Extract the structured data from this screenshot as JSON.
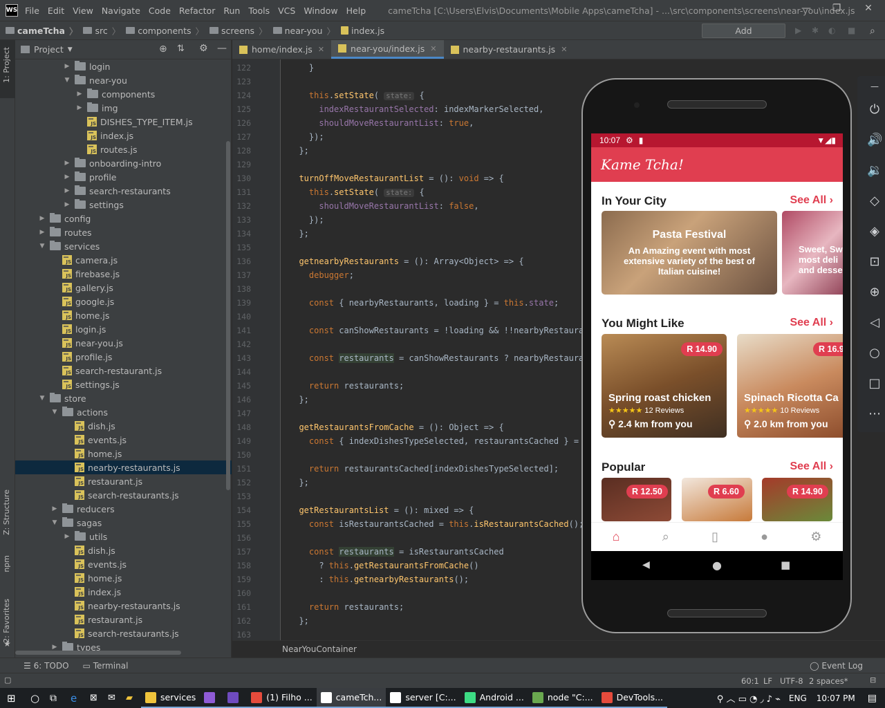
{
  "app": {
    "logo": "WS",
    "title": "cameTcha [C:\\Users\\Elvis\\Documents\\Mobile Apps\\cameTcha] - ...\\src\\components\\screens\\near-you\\index.js"
  },
  "menu": [
    "File",
    "Edit",
    "View",
    "Navigate",
    "Code",
    "Refactor",
    "Run",
    "Tools",
    "VCS",
    "Window",
    "Help"
  ],
  "breadcrumb": [
    "cameTcha",
    "src",
    "components",
    "screens",
    "near-you",
    "index.js"
  ],
  "toolbar": {
    "add_config": "Add Configuration..."
  },
  "left_tabs": {
    "project": "1: Project",
    "structure": "Z: Structure",
    "npm": "npm",
    "favorites": "2: Favorites"
  },
  "project_panel": {
    "title": "Project"
  },
  "tree": [
    {
      "d": 4,
      "t": "f",
      "a": "r",
      "n": "login"
    },
    {
      "d": 4,
      "t": "f",
      "a": "d",
      "n": "near-you"
    },
    {
      "d": 5,
      "t": "f",
      "a": "r",
      "n": "components"
    },
    {
      "d": 5,
      "t": "f",
      "a": "r",
      "n": "img"
    },
    {
      "d": 5,
      "t": "j",
      "n": "DISHES_TYPE_ITEM.js"
    },
    {
      "d": 5,
      "t": "j",
      "n": "index.js"
    },
    {
      "d": 5,
      "t": "j",
      "n": "routes.js"
    },
    {
      "d": 4,
      "t": "f",
      "a": "r",
      "n": "onboarding-intro"
    },
    {
      "d": 4,
      "t": "f",
      "a": "r",
      "n": "profile"
    },
    {
      "d": 4,
      "t": "f",
      "a": "r",
      "n": "search-restaurants"
    },
    {
      "d": 4,
      "t": "f",
      "a": "r",
      "n": "settings"
    },
    {
      "d": 2,
      "t": "f",
      "a": "r",
      "n": "config"
    },
    {
      "d": 2,
      "t": "f",
      "a": "r",
      "n": "routes"
    },
    {
      "d": 2,
      "t": "f",
      "a": "d",
      "n": "services"
    },
    {
      "d": 3,
      "t": "j",
      "n": "camera.js"
    },
    {
      "d": 3,
      "t": "j",
      "n": "firebase.js"
    },
    {
      "d": 3,
      "t": "j",
      "n": "gallery.js"
    },
    {
      "d": 3,
      "t": "j",
      "n": "google.js"
    },
    {
      "d": 3,
      "t": "j",
      "n": "home.js"
    },
    {
      "d": 3,
      "t": "j",
      "n": "login.js"
    },
    {
      "d": 3,
      "t": "j",
      "n": "near-you.js"
    },
    {
      "d": 3,
      "t": "j",
      "n": "profile.js"
    },
    {
      "d": 3,
      "t": "j",
      "n": "search-restaurant.js"
    },
    {
      "d": 3,
      "t": "j",
      "n": "settings.js"
    },
    {
      "d": 2,
      "t": "f",
      "a": "d",
      "n": "store"
    },
    {
      "d": 3,
      "t": "f",
      "a": "d",
      "n": "actions"
    },
    {
      "d": 4,
      "t": "j",
      "n": "dish.js"
    },
    {
      "d": 4,
      "t": "j",
      "n": "events.js"
    },
    {
      "d": 4,
      "t": "j",
      "n": "home.js"
    },
    {
      "d": 4,
      "t": "j",
      "n": "nearby-restaurants.js",
      "sel": true
    },
    {
      "d": 4,
      "t": "j",
      "n": "restaurant.js"
    },
    {
      "d": 4,
      "t": "j",
      "n": "search-restaurants.js"
    },
    {
      "d": 3,
      "t": "f",
      "a": "r",
      "n": "reducers"
    },
    {
      "d": 3,
      "t": "f",
      "a": "d",
      "n": "sagas"
    },
    {
      "d": 4,
      "t": "f",
      "a": "r",
      "n": "utils"
    },
    {
      "d": 4,
      "t": "j",
      "n": "dish.js"
    },
    {
      "d": 4,
      "t": "j",
      "n": "events.js"
    },
    {
      "d": 4,
      "t": "j",
      "n": "home.js"
    },
    {
      "d": 4,
      "t": "j",
      "n": "index.js"
    },
    {
      "d": 4,
      "t": "j",
      "n": "nearby-restaurants.js"
    },
    {
      "d": 4,
      "t": "j",
      "n": "restaurant.js"
    },
    {
      "d": 4,
      "t": "j",
      "n": "search-restaurants.js"
    },
    {
      "d": 3,
      "t": "f",
      "a": "r",
      "n": "types"
    }
  ],
  "tabs": [
    {
      "label": "home/index.js"
    },
    {
      "label": "near-you/index.js",
      "active": true
    },
    {
      "label": "nearby-restaurants.js"
    }
  ],
  "code": [
    {
      "n": "122",
      "h": "    }"
    },
    {
      "n": "123",
      "h": ""
    },
    {
      "n": "124",
      "h": "    <span class='kw'>this</span>.<span class='fn'>setState</span>( <span class='hint'>state:</span> {"
    },
    {
      "n": "125",
      "h": "      <span class='pr'>indexRestaurantSelected</span>: indexMarkerSelected,"
    },
    {
      "n": "126",
      "h": "      <span class='pr'>shouldMoveRestaurantList</span>: <span class='kw'>true</span>,"
    },
    {
      "n": "127",
      "h": "    });"
    },
    {
      "n": "128",
      "h": "  };"
    },
    {
      "n": "129",
      "h": ""
    },
    {
      "n": "130",
      "h": "  <span class='fn'>turnOffMoveRestaurantList</span> = (): <span class='kw'>void</span> => {"
    },
    {
      "n": "131",
      "h": "    <span class='kw'>this</span>.<span class='fn'>setState</span>( <span class='hint'>state:</span> {"
    },
    {
      "n": "132",
      "h": "      <span class='pr'>shouldMoveRestaurantList</span>: <span class='kw'>false</span>,"
    },
    {
      "n": "133",
      "h": "    });"
    },
    {
      "n": "134",
      "h": "  };"
    },
    {
      "n": "135",
      "h": ""
    },
    {
      "n": "136",
      "h": "  <span class='fn'>getnearbyRestaurants</span> = (): Array&lt;Object&gt; => {"
    },
    {
      "n": "137",
      "h": "    <span class='dbg'>debugger</span>;"
    },
    {
      "n": "138",
      "h": ""
    },
    {
      "n": "139",
      "h": "    <span class='kw'>const</span> { nearbyRestaurants, loading } = <span class='kw'>this</span>.<span class='pr'>state</span>;"
    },
    {
      "n": "140",
      "h": ""
    },
    {
      "n": "141",
      "h": "    <span class='kw'>const</span> canShowRestaurants = !loading &amp;&amp; !!nearbyRestaurants"
    },
    {
      "n": "142",
      "h": ""
    },
    {
      "n": "143",
      "h": "    <span class='kw'>const</span> <span class='hl'>restaurants</span> = canShowRestaurants ? nearbyRestaurants"
    },
    {
      "n": "144",
      "h": ""
    },
    {
      "n": "145",
      "h": "    <span class='kw'>return</span> restaurants;"
    },
    {
      "n": "146",
      "h": "  };"
    },
    {
      "n": "147",
      "h": ""
    },
    {
      "n": "148",
      "h": "  <span class='fn'>getRestaurantsFromCache</span> = (): Object => {"
    },
    {
      "n": "149",
      "h": "    <span class='kw'>const</span> { indexDishesTypeSelected, restaurantsCached } = <span class='kw'>thi</span>"
    },
    {
      "n": "150",
      "h": ""
    },
    {
      "n": "151",
      "h": "    <span class='kw'>return</span> restaurantsCached[indexDishesTypeSelected];"
    },
    {
      "n": "152",
      "h": "  };"
    },
    {
      "n": "153",
      "h": ""
    },
    {
      "n": "154",
      "h": "  <span class='fn'>getRestaurantsList</span> = (): mixed => {"
    },
    {
      "n": "155",
      "h": "    <span class='kw'>const</span> isRestaurantsCached = <span class='kw'>this</span>.<span class='fn'>isRestaurantsCached</span>();"
    },
    {
      "n": "156",
      "h": ""
    },
    {
      "n": "157",
      "h": "    <span class='kw'>const</span> <span class='hl'>restaurants</span> = isRestaurantsCached"
    },
    {
      "n": "158",
      "h": "      ? <span class='kw'>this</span>.<span class='fn'>getRestaurantsFromCache</span>()"
    },
    {
      "n": "159",
      "h": "      : <span class='kw'>this</span>.<span class='fn'>getnearbyRestaurants</span>();"
    },
    {
      "n": "160",
      "h": ""
    },
    {
      "n": "161",
      "h": "    <span class='kw'>return</span> restaurants;"
    },
    {
      "n": "162",
      "h": "  };"
    },
    {
      "n": "163",
      "h": ""
    }
  ],
  "editor_breadcrumb": "NearYouContainer",
  "bottom_tabs": {
    "todo": "6: TODO",
    "terminal": "Terminal",
    "event_log": "Event Log"
  },
  "status": {
    "pos": "60:1",
    "lf": "LF",
    "enc": "UTF-8",
    "indent": "2 spaces*"
  },
  "phone": {
    "time": "10:07",
    "app_title": "Kame Tcha!",
    "in_city": "In Your City",
    "see_all": "See All",
    "event1_title": "Pasta Festival",
    "event1_desc": "An Amazing event with most extensive variety of the best of Italian cuisine!",
    "event2_desc": "Sweet, Sw most deli and desser",
    "you_might_like": "You Might Like",
    "dish1_price": "R 14.90",
    "dish1_title": "Spring roast chicken",
    "dish1_reviews": "12 Reviews",
    "dish1_dist": "2.4 km from you",
    "dish2_price": "R 16.9",
    "dish2_title": "Spinach Ricotta Ca",
    "dish2_reviews": "10 Reviews",
    "dish2_dist": "2.0 km from you",
    "popular": "Popular",
    "pop1": "R 12.50",
    "pop2": "R 6.60",
    "pop3": "R 14.90",
    "stars": "★★★★★"
  },
  "taskbar": {
    "items": [
      {
        "label": "services",
        "open": true,
        "color": "#f0c43c"
      },
      {
        "label": "",
        "open": true,
        "color": "#8f5bd6"
      },
      {
        "label": "",
        "open": true,
        "color": "#6f4bbf"
      },
      {
        "label": "(1) Filho ...",
        "open": true,
        "color": "#e54b3c"
      },
      {
        "label": "cameTch...",
        "open": true,
        "color": "#ffffff",
        "active": true
      },
      {
        "label": "server [C:...",
        "open": true,
        "color": "#ffffff"
      },
      {
        "label": "Android ...",
        "open": true,
        "color": "#3ddc84"
      },
      {
        "label": "node \"C:...",
        "open": true,
        "color": "#6aa84f"
      },
      {
        "label": "DevTools...",
        "open": true,
        "color": "#e54b3c"
      }
    ],
    "lang": "ENG",
    "clock": "10:07 PM"
  }
}
